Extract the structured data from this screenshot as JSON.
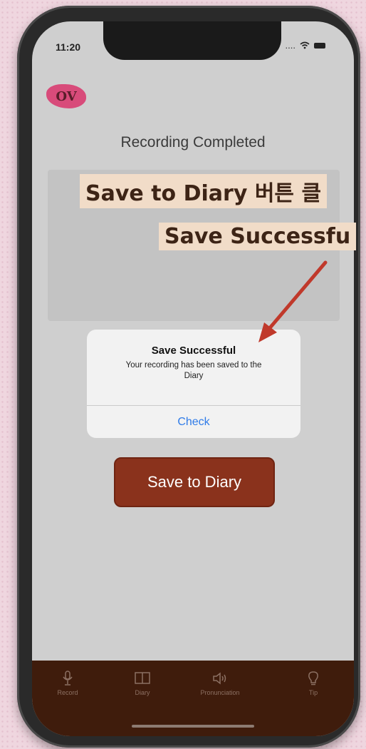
{
  "status_bar": {
    "time": "11:20",
    "signal": "...."
  },
  "logo": {
    "text": "OV"
  },
  "page_title": "Recording Completed",
  "annotations": {
    "line1": "Save to Diary 버튼 클",
    "line2": "Save Successfu"
  },
  "dialog": {
    "title": "Save Successful",
    "message": "Your recording has been saved to the Diary",
    "button": "Check"
  },
  "save_button": "Save to Diary",
  "tabs": [
    {
      "label": "Record",
      "icon": "microphone-icon"
    },
    {
      "label": "Diary",
      "icon": "book-icon"
    },
    {
      "label": "Pronunciation",
      "icon": "speaker-icon"
    },
    {
      "label": "Tip",
      "icon": "lightbulb-icon"
    }
  ],
  "colors": {
    "accent": "#8a321c",
    "tabbar": "#3f1c0c",
    "logo": "#d84b7a",
    "link": "#2f7be8",
    "annotation_bg": "#f1dcc8",
    "arrow": "#c0392b"
  }
}
